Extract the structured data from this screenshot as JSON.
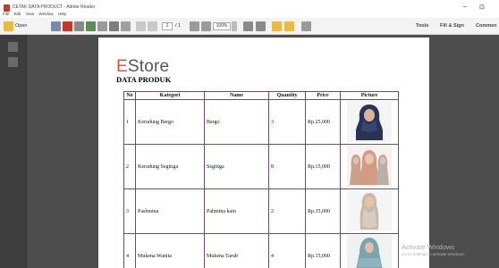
{
  "window": {
    "title": "CETAK DATA PRODUCT - Adobe Reader",
    "menu": [
      "File",
      "Edit",
      "View",
      "Window",
      "Help"
    ],
    "minimize": "–",
    "restore": "⊡"
  },
  "toolbar": {
    "open_label": "Open",
    "page_current": "1",
    "page_total": "/ 1",
    "zoom": "100%",
    "tools_label": "Tools",
    "fill_sign_label": "Fill & Sign",
    "comment_label": "Commen"
  },
  "document": {
    "brand_first": "E",
    "brand_rest": "Store",
    "title": "DATA PRODUK",
    "columns": [
      "No",
      "Kategori",
      "Name",
      "Quantity",
      "Price",
      "Picture"
    ],
    "rows": [
      {
        "no": "1",
        "kategori": "Kerudung Bergo",
        "name": "Bergo",
        "quantity": "3",
        "price": "Rp.25,000",
        "picture": "hijab-bergo-photo"
      },
      {
        "no": "2",
        "kategori": "Kerudung Segitiga",
        "name": "Segitiga",
        "quantity": "8",
        "price": "Rp.15,000",
        "picture": "hijab-segitiga-photo"
      },
      {
        "no": "3",
        "kategori": "Pashmina",
        "name": "Pahmina kain",
        "quantity": "2",
        "price": "Rp.35,000",
        "picture": "pashmina-photo"
      },
      {
        "no": "4",
        "kategori": "Mukena Wanita",
        "name": "Mukena Tarub",
        "quantity": "4",
        "price": "Rp.15,000",
        "picture": "mukena-photo"
      }
    ]
  },
  "watermark": {
    "line1": "Activate Windows",
    "line2": "Go to Settings to activate Windows."
  },
  "colors": {
    "brand_accent": "#e8503a",
    "table_border": "#6b4b7a",
    "viewer_background": "#4d4d4d"
  }
}
